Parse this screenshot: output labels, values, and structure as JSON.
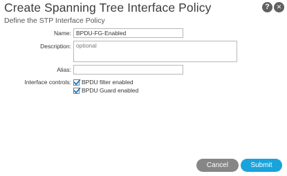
{
  "dialog": {
    "title": "Create Spanning Tree Interface Policy",
    "subtitle": "Define the STP Interface Policy",
    "help_icon_glyph": "?",
    "close_icon_glyph": "✕",
    "icons": [
      "help-icon",
      "close-icon"
    ]
  },
  "form": {
    "name_label": "Name:",
    "name_value": "BPDU-FG-Enabled",
    "description_label": "Description:",
    "description_placeholder": "optional",
    "alias_label": "Alias:",
    "alias_value": "",
    "interface_controls_label": "Interface controls:",
    "controls": [
      {
        "label": "BPDU filter enabled",
        "checked": true
      },
      {
        "label": "BPDU Guard enabled",
        "checked": true
      }
    ]
  },
  "buttons": {
    "cancel_label": "Cancel",
    "submit_label": "Submit"
  },
  "colors": {
    "submit_button": "#1aa3db",
    "cancel_button": "#868686",
    "icon_background": "#606060",
    "checkmark": "#1a73b8"
  }
}
